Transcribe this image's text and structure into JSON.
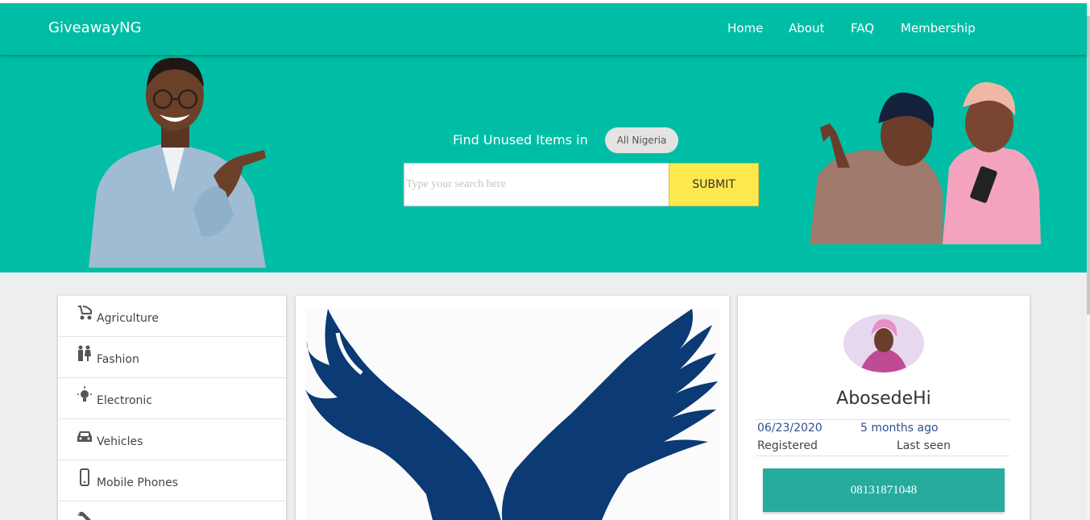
{
  "nav": {
    "brand": "GiveawayNG",
    "links": [
      "Home",
      "About",
      "FAQ",
      "Membership"
    ]
  },
  "hero": {
    "find_text": "Find Unused Items in",
    "location": "All Nigeria",
    "search_placeholder": "Type your search here",
    "submit_label": "SUBMIT"
  },
  "categories": [
    {
      "label": "Agriculture",
      "icon": "stroller-icon"
    },
    {
      "label": "Fashion",
      "icon": "people-icon"
    },
    {
      "label": "Electronic",
      "icon": "lightbulb-icon"
    },
    {
      "label": "Vehicles",
      "icon": "car-icon"
    },
    {
      "label": "Mobile Phones",
      "icon": "mobile-phone-icon"
    },
    {
      "label": "",
      "icon": "wrench-icon"
    }
  ],
  "profile": {
    "username": "AbosedeHi",
    "registered_date": "06/23/2020",
    "last_seen_ago": "5 months ago",
    "registered_label": "Registered",
    "last_seen_label": "Last seen",
    "phone": "08131871048"
  },
  "colors": {
    "primary": "#00bea5",
    "submit": "#fde84d",
    "phone_button": "#26ac9d",
    "eagle": "#0b3a74"
  }
}
